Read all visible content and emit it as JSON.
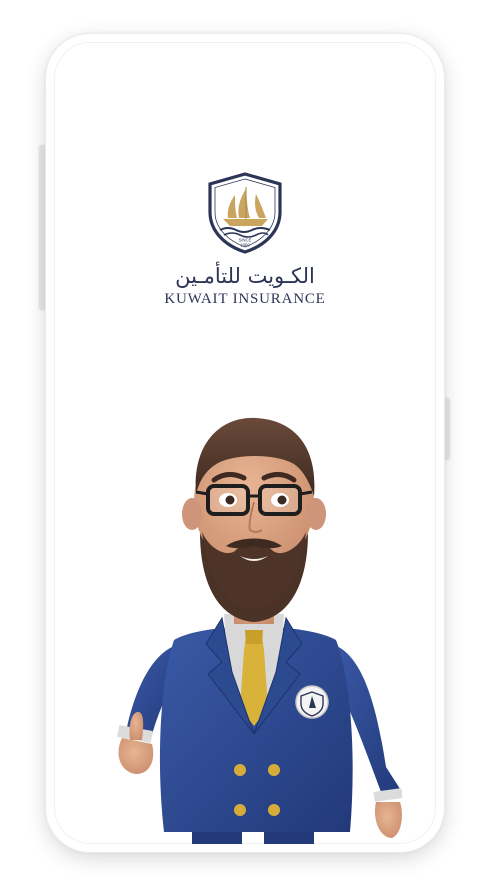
{
  "brand": {
    "name_ar": "الكـويت للتأمـين",
    "name_en": "KUWAIT INSURANCE",
    "since_label": "SINCE",
    "since_year": "1960",
    "logo_icon": "sailing-ship-shield-icon"
  },
  "mascot": {
    "icon": "business-mascot-thumbs-up",
    "badge_icon": "sailing-ship-badge-icon"
  },
  "colors": {
    "navy": "#2d3557",
    "gold": "#c9a560",
    "suit": "#2c4a8f"
  }
}
